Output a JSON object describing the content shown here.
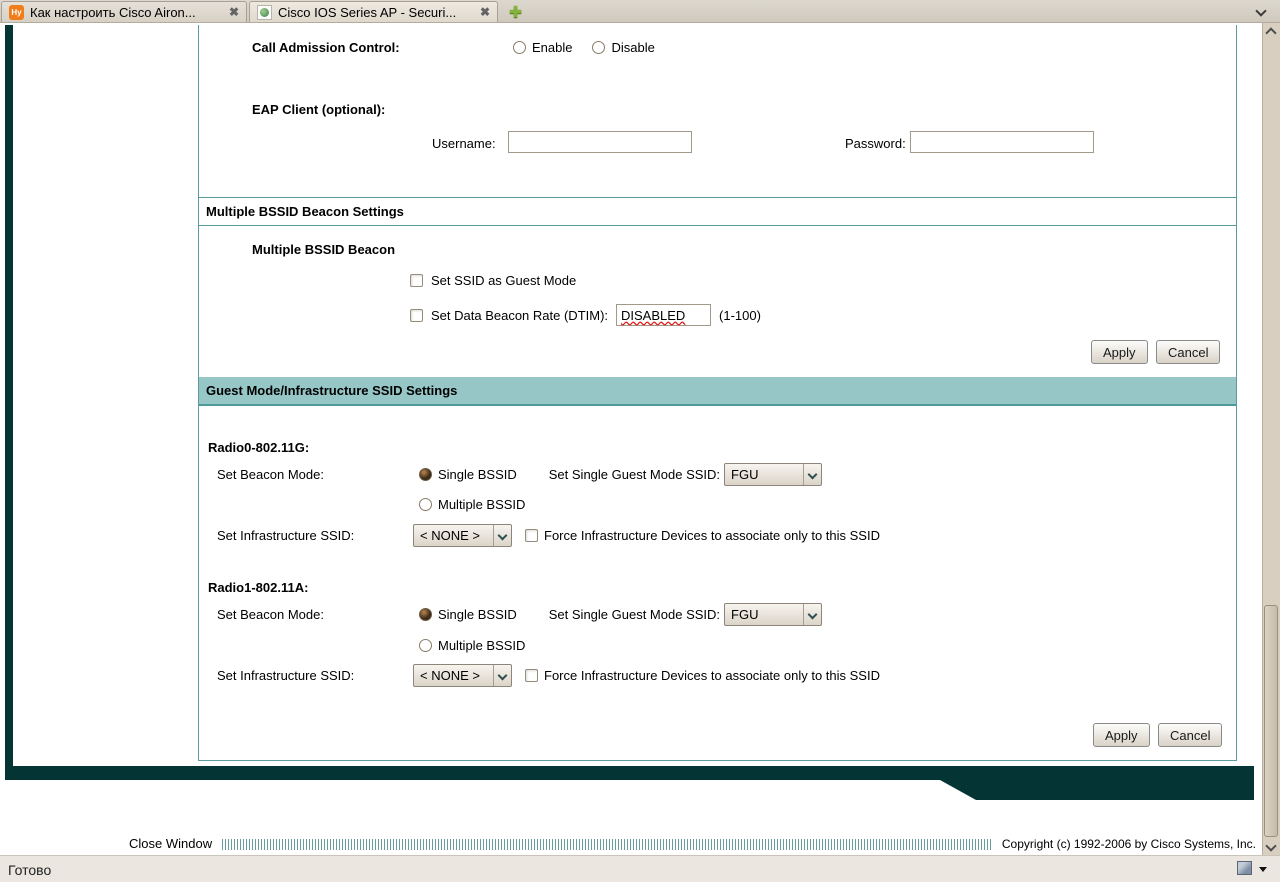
{
  "tab_bar": {
    "tabs": [
      {
        "title": "Как настроить Cisco Airon...",
        "favicon": "Hy"
      },
      {
        "title": "Cisco IOS Series AP - Securi..."
      }
    ],
    "close_glyph": "✖",
    "new_tab_glyph": "✚"
  },
  "content": {
    "call_admission_label": "Call Admission Control:",
    "enable_label": "Enable",
    "disable_label": "Disable",
    "eap_client_label": "EAP Client (optional):",
    "username_label": "Username:",
    "username_value": "",
    "password_label": "Password:",
    "password_value": "",
    "bssid_header": "Multiple BSSID Beacon Settings",
    "bssid_sublabel": "Multiple BSSID Beacon",
    "guest_mode_checkbox_label": "Set SSID as Guest Mode",
    "dtim_checkbox_label": "Set Data Beacon Rate (DTIM):",
    "dtim_value": "DISABLED",
    "dtim_range": "(1-100)",
    "apply_label": "Apply",
    "cancel_label": "Cancel",
    "guest_header": "Guest Mode/Infrastructure SSID Settings",
    "radio0_title": "Radio0-802.11G:",
    "radio1_title": "Radio1-802.11A:",
    "beacon_mode_label": "Set Beacon Mode:",
    "single_bssid_label": "Single BSSID",
    "multiple_bssid_label": "Multiple BSSID",
    "guest_ssid_label": "Set Single Guest Mode SSID:",
    "guest_ssid_value": "FGU",
    "infra_ssid_label": "Set Infrastructure SSID:",
    "infra_ssid_value": "< NONE >",
    "force_assoc_label": "Force Infrastructure Devices to associate only to this SSID"
  },
  "footer": {
    "close_window_label": "Close Window",
    "copyright": "Copyright (c) 1992-2006 by Cisco Systems, Inc."
  },
  "status_bar": {
    "text": "Готово"
  },
  "colors": {
    "dark_teal": "#053434",
    "header_teal": "#96c6c6",
    "panel_border": "#5a9b9b"
  }
}
